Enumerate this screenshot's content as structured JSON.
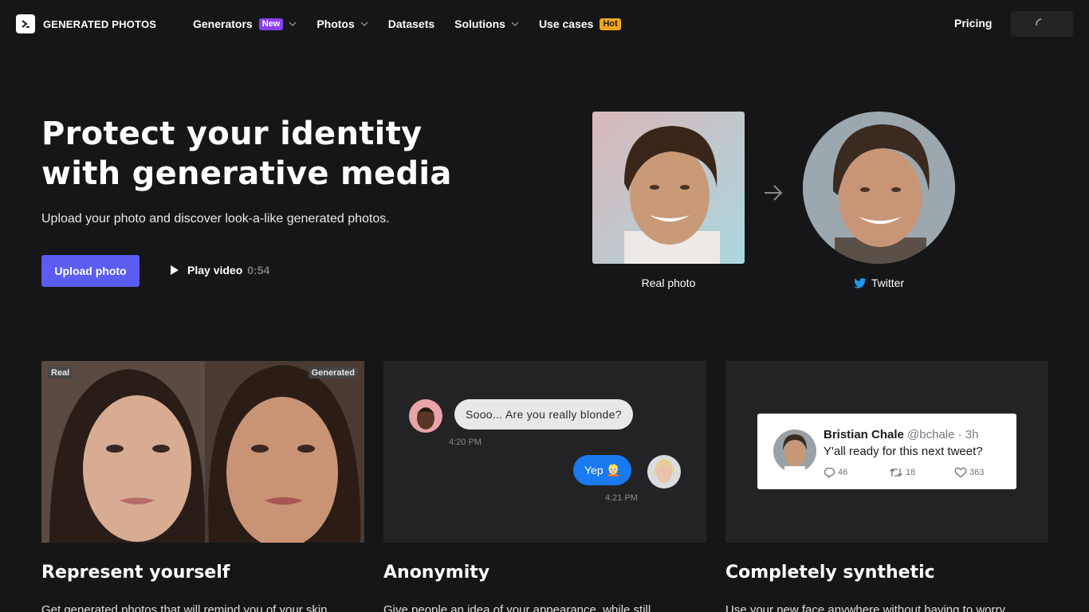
{
  "nav": {
    "logo_text": "GENERATED PHOTOS",
    "items": [
      {
        "label": "Generators",
        "badge": "New",
        "dropdown": true
      },
      {
        "label": "Photos",
        "dropdown": true
      },
      {
        "label": "Datasets"
      },
      {
        "label": "Solutions",
        "dropdown": true
      },
      {
        "label": "Use cases",
        "badge": "Hot"
      }
    ],
    "pricing": "Pricing"
  },
  "hero": {
    "title_line1": "Protect your identity",
    "title_line2": "with generative media",
    "subtitle": "Upload your photo and discover look-a-like generated photos.",
    "upload_button": "Upload photo",
    "play_label": "Play video",
    "play_duration": "0:54",
    "real_label": "Real photo",
    "generated_label": "Twitter"
  },
  "cards": [
    {
      "title": "Represent yourself",
      "text": "Get generated photos that will remind you of your skin",
      "tag_left": "Real",
      "tag_right": "Generated"
    },
    {
      "title": "Anonymity",
      "text": "Give people an idea of your appearance, while still",
      "chat": {
        "incoming": "Sooo... Are you really blonde?",
        "incoming_time": "4:20 PM",
        "outgoing": "Yep 👱🏻",
        "outgoing_time": "4:21 PM"
      }
    },
    {
      "title": "Completely synthetic",
      "text": "Use your new face anywhere without having to worry",
      "tweet": {
        "name": "Bristian Chale",
        "handle": "@bchale · 3h",
        "text": "Y'all ready for this next tweet?",
        "replies": "46",
        "retweets": "18",
        "likes": "363"
      }
    }
  ],
  "colors": {
    "background": "#161618",
    "card": "#232325",
    "accent": "#5a5cf2",
    "badge_new": "#8b3ff0",
    "badge_hot": "#f2a51a",
    "chat_blue": "#1a7af0",
    "twitter": "#1d9bf0"
  }
}
